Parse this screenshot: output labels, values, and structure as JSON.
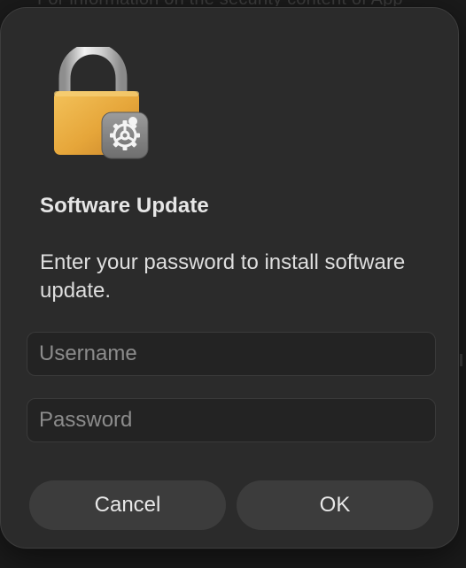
{
  "dialog": {
    "title": "Software Update",
    "message": "Enter your password to install software update.",
    "icon": "lock-with-gear-icon"
  },
  "fields": {
    "username_placeholder": "Username",
    "username_value": "",
    "password_placeholder": "Password",
    "password_value": ""
  },
  "buttons": {
    "cancel_label": "Cancel",
    "ok_label": "OK"
  },
  "background": {
    "partial_text": "For information on the security content of App"
  },
  "colors": {
    "dialog_bg": "#2b2b2b",
    "button_bg": "#3c3c3c",
    "lock_gold": "#e9aa3c",
    "text": "#e6e6e6"
  }
}
